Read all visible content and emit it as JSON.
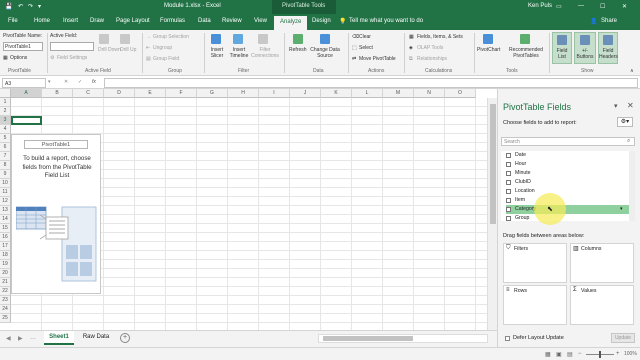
{
  "window": {
    "title": "Module 1.xlsx - Excel",
    "context_tab_group": "PivotTable Tools",
    "user": "Ken Puls",
    "colors": {
      "accent": "#217346",
      "highlight": "#85c399",
      "selected_field": "#8fd19e"
    }
  },
  "ribbon_tabs": [
    {
      "label": "File"
    },
    {
      "label": "Home"
    },
    {
      "label": "Insert"
    },
    {
      "label": "Draw"
    },
    {
      "label": "Page Layout"
    },
    {
      "label": "Formulas"
    },
    {
      "label": "Data"
    },
    {
      "label": "Review"
    },
    {
      "label": "View"
    },
    {
      "label": "Analyze"
    },
    {
      "label": "Design"
    }
  ],
  "tell_me": "Tell me what you want to do",
  "share": "Share",
  "ribbon": {
    "pivottable": {
      "name_label": "PivotTable Name:",
      "name_value": "PivotTable1",
      "options": "Options",
      "group": "PivotTable"
    },
    "active_field": {
      "label": "Active Field:",
      "value": "",
      "field_settings": "Field Settings",
      "drill_down": "Drill Down",
      "drill_up": "Drill Up",
      "group": "Active Field"
    },
    "group_grp": {
      "group_selection": "Group Selection",
      "ungroup": "Ungroup",
      "group_field": "Group Field",
      "group": "Group"
    },
    "filter": {
      "insert_slicer": "Insert Slicer",
      "insert_timeline": "Insert Timeline",
      "filter_connections": "Filter Connections",
      "group": "Filter"
    },
    "data": {
      "refresh": "Refresh",
      "change_source": "Change Data Source",
      "group": "Data"
    },
    "actions": {
      "clear": "Clear",
      "select": "Select",
      "move": "Move PivotTable",
      "group": "Actions"
    },
    "calculations": {
      "fields_items": "Fields, Items, & Sets",
      "olap": "OLAP Tools",
      "relationships": "Relationships",
      "group": "Calculations"
    },
    "tools": {
      "pivotchart": "PivotChart",
      "recommended": "Recommended PivotTables",
      "group": "Tools"
    },
    "show": {
      "field_list": "Field List",
      "buttons": "+/- Buttons",
      "headers": "Field Headers",
      "group": "Show"
    }
  },
  "formula_bar": {
    "name_box": "A3",
    "fx": "fx",
    "value": ""
  },
  "grid": {
    "columns": [
      "A",
      "B",
      "C",
      "D",
      "E",
      "F",
      "G",
      "H",
      "I",
      "J",
      "K",
      "L",
      "M",
      "N",
      "O"
    ],
    "rows": [
      "1",
      "2",
      "3",
      "4",
      "5",
      "6",
      "7",
      "8",
      "9",
      "10",
      "11",
      "12",
      "13",
      "14",
      "15",
      "16",
      "17",
      "18",
      "19",
      "20",
      "21",
      "22",
      "23",
      "24",
      "25"
    ],
    "pivot_placeholder": {
      "title": "PivotTable1",
      "message": "To build a report, choose fields from the PivotTable Field List"
    }
  },
  "pane": {
    "title": "PivotTable Fields",
    "subtitle": "Choose fields to add to report:",
    "search_placeholder": "Search",
    "fields": [
      {
        "label": "Date"
      },
      {
        "label": "Hour"
      },
      {
        "label": "Minute"
      },
      {
        "label": "ClubID"
      },
      {
        "label": "Location"
      },
      {
        "label": "Item"
      },
      {
        "label": "Category"
      },
      {
        "label": "Group"
      }
    ],
    "drag_label": "Drag fields between areas below:",
    "areas": {
      "filters": "Filters",
      "columns": "Columns",
      "rows": "Rows",
      "values": "Values"
    },
    "defer": "Defer Layout Update",
    "update": "Update"
  },
  "sheets": [
    {
      "label": "Sheet1",
      "active": true
    },
    {
      "label": "Raw Data",
      "active": false
    }
  ],
  "status": {
    "zoom": "100%"
  }
}
